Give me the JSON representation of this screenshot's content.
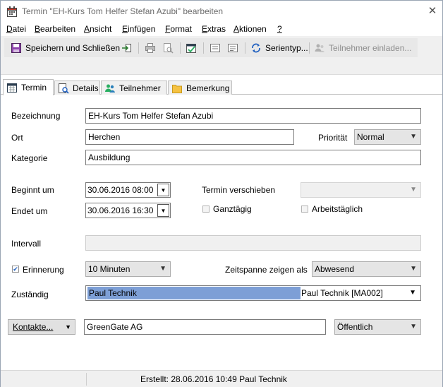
{
  "window": {
    "title": "Termin \"EH-Kurs Tom Helfer Stefan Azubi\" bearbeiten"
  },
  "menu": {
    "datei": "Datei",
    "bearbeiten": "Bearbeiten",
    "ansicht": "Ansicht",
    "einfuegen": "Einfügen",
    "format": "Format",
    "extras": "Extras",
    "aktionen": "Aktionen",
    "help": "?"
  },
  "toolbar": {
    "save_close": "Speichern und Schließen",
    "serientyp": "Serientyp...",
    "invite": "Teilnehmer einladen..."
  },
  "tabs": {
    "termin": "Termin",
    "details": "Details",
    "teilnehmer": "Teilnehmer",
    "bemerkung": "Bemerkung"
  },
  "form": {
    "bezeichnung_label": "Bezeichnung",
    "bezeichnung": "EH-Kurs Tom Helfer Stefan Azubi",
    "ort_label": "Ort",
    "ort": "Herchen",
    "prioritaet_label": "Priorität",
    "prioritaet": "Normal",
    "kategorie_label": "Kategorie",
    "kategorie": "Ausbildung",
    "beginn_label": "Beginnt um",
    "beginn": "30.06.2016 08:00",
    "ende_label": "Endet um",
    "ende": "30.06.2016 16:30",
    "verschieben_label": "Termin verschieben",
    "ganztaegig_label": "Ganztägig",
    "arbeitstaeglich_label": "Arbeitstäglich",
    "intervall_label": "Intervall",
    "erinnerung_label": "Erinnerung",
    "erinnerung_checked": true,
    "erinnerung": "10 Minuten",
    "zeitspanne_label": "Zeitspanne zeigen als",
    "zeitspanne": "Abwesend",
    "zustaendig_label": "Zuständig",
    "zustaendig_name": "Paul Technik",
    "zustaendig_full": "Paul Technik [MA002]",
    "kontakte_button": "Kontakte...",
    "kontakt": "GreenGate AG",
    "sichtbarkeit": "Öffentlich"
  },
  "status": {
    "created": "Erstellt: 28.06.2016 10:49 Paul Technik"
  },
  "colors": {
    "highlight": "#7d9fd6",
    "accent": "#1f5fbf"
  }
}
